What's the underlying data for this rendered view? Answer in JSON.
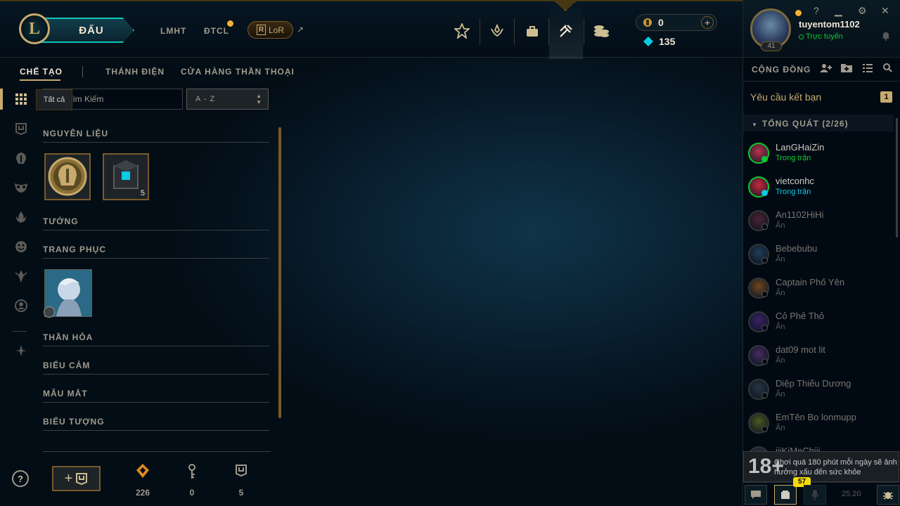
{
  "header": {
    "logo_letter": "L",
    "play_label": "ĐẤU",
    "modes": [
      "LMHT",
      "ĐTCL"
    ],
    "lor_label": "LoR",
    "lor_icon": "R",
    "external_arrow": "↗",
    "nav_icons": [
      "home-icon",
      "profile-icon",
      "collection-icon",
      "loot-icon",
      "store-icon"
    ],
    "currency": {
      "rp": "0",
      "be": "135"
    }
  },
  "profile": {
    "username": "tuyentom1102",
    "status": "Trực tuyến",
    "level": "41"
  },
  "social": {
    "title": "CỘNG ĐỒNG",
    "friend_requests_label": "Yêu cầu kết bạn",
    "friend_requests_count": "1",
    "group_label": "TỔNG QUÁT (2/26)",
    "friends": [
      {
        "name": "LanGHaiZin",
        "status": "Trong trận",
        "state": "game"
      },
      {
        "name": "vietconhc",
        "status": "Trong trận",
        "state": "game2"
      },
      {
        "name": "An1102HiHi",
        "status": "Ẩn",
        "state": "off"
      },
      {
        "name": "Bebebubu",
        "status": "Ẩn",
        "state": "off"
      },
      {
        "name": "Captain Phố Yên",
        "status": "Ẩn",
        "state": "off"
      },
      {
        "name": "Cỏ Phê Thỏ",
        "status": "Ẩn",
        "state": "off"
      },
      {
        "name": "dat09 mot lit",
        "status": "Ẩn",
        "state": "off"
      },
      {
        "name": "Diệp Thiếu Dương",
        "status": "Ẩn",
        "state": "off"
      },
      {
        "name": "EmTên Bo lonmupp",
        "status": "Ẩn",
        "state": "off"
      },
      {
        "name": "iiiKiMeChiii",
        "status": "",
        "state": "off"
      }
    ],
    "warning_badge": "18+",
    "warning_text": "Chơi quá 180 phút mỗi ngày sẽ ảnh hưởng xấu đến sức khỏe",
    "notifications_count": "57",
    "version": "25.20"
  },
  "subnav": {
    "tabs": [
      "CHẾ TẠO",
      "THÁNH ĐIỆN",
      "CỬA HÀNG THẦN THOẠI"
    ]
  },
  "filters": {
    "tooltip": "Tất cả",
    "search_placeholder": "Tìm Kiếm",
    "sort_value": "A - Z"
  },
  "sections": {
    "materials": "NGUYÊN LIỆU",
    "champions": "TƯỚNG",
    "skins": "TRANG PHỤC",
    "wards": "THẦN HỎA",
    "emotes": "BIỂU CẢM",
    "eyes": "MẪU MẮT",
    "icons": "BIỂU TƯỢNG"
  },
  "loot": {
    "key_fragment_count": "5"
  },
  "footer": {
    "help": "?",
    "craft_plus": "+",
    "orange_essence": "226",
    "keys": "0",
    "chests": "5"
  }
}
